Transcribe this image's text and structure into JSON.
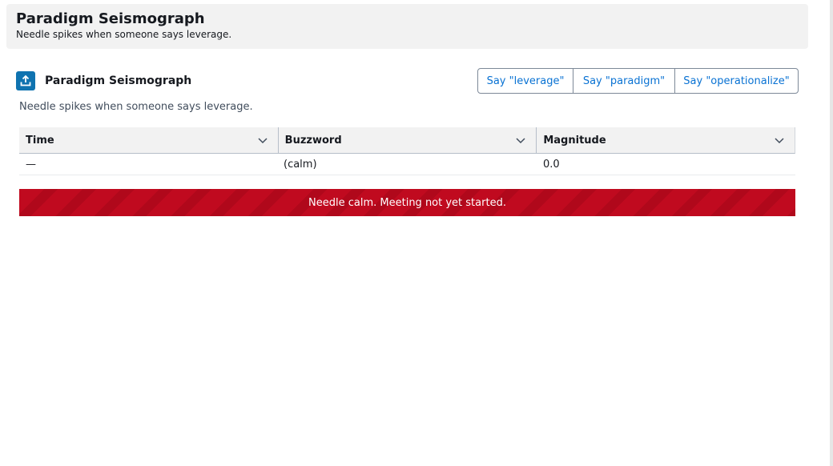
{
  "banner": {
    "title": "Paradigm Seismograph",
    "subtitle": "Needle spikes when someone says leverage."
  },
  "panel": {
    "icon": "upload-icon",
    "title": "Paradigm Seismograph",
    "description": "Needle spikes when someone says leverage."
  },
  "buttons": {
    "leverage": "Say \"leverage\"",
    "paradigm": "Say \"paradigm\"",
    "operationalize": "Say \"operationalize\""
  },
  "table": {
    "columns": [
      "Time",
      "Buzzword",
      "Magnitude"
    ],
    "rows": [
      {
        "time": "—",
        "buzzword": "(calm)",
        "magnitude": "0.0"
      }
    ]
  },
  "alert": {
    "text": "Needle calm. Meeting not yet started.",
    "color": "#c00a1f"
  },
  "colors": {
    "accent": "#0972d3",
    "icon_bg": "#0f73b0"
  }
}
